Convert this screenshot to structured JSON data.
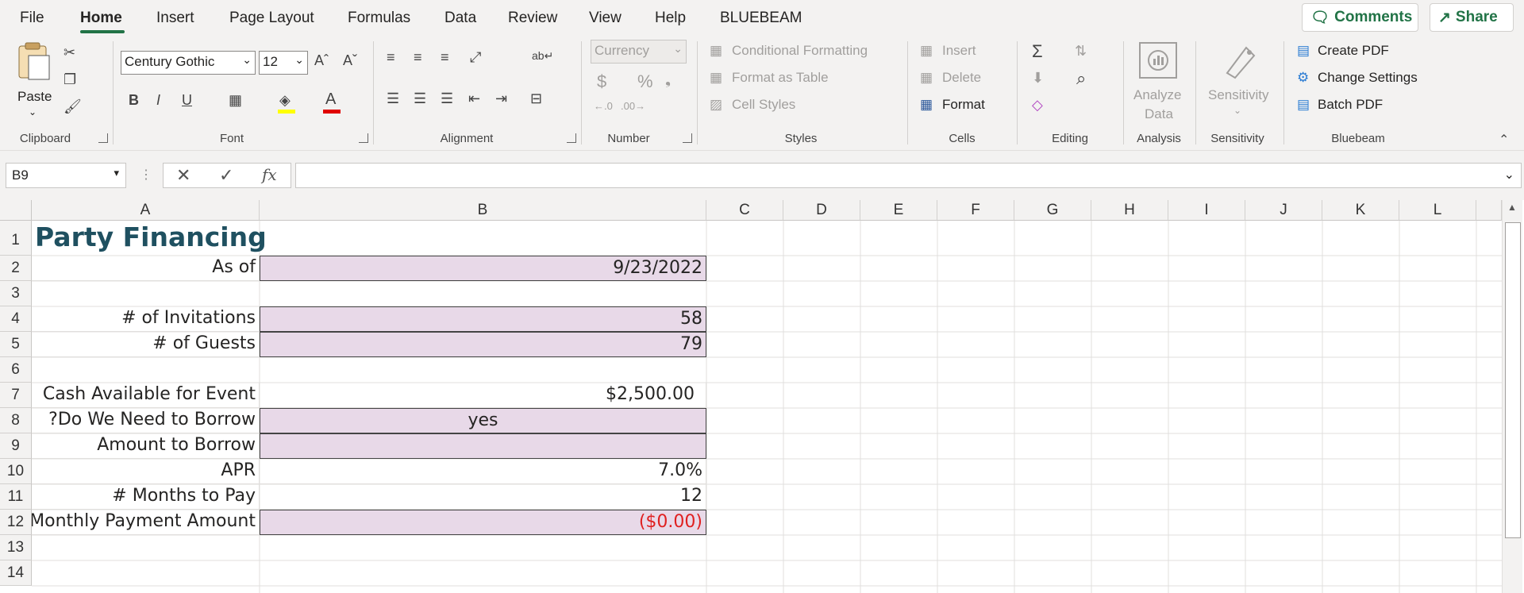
{
  "menu": {
    "tabs": [
      "File",
      "Home",
      "Insert",
      "Page Layout",
      "Formulas",
      "Data",
      "Review",
      "View",
      "Help",
      "BLUEBEAM"
    ],
    "active_tab": "Home",
    "comments_label": "Comments",
    "share_label": "Share"
  },
  "ribbon": {
    "clipboard": {
      "paste_label": "Paste",
      "group_label": "Clipboard"
    },
    "font": {
      "font_name": "Century Gothic",
      "font_size": "12",
      "group_label": "Font",
      "bold": "B",
      "italic": "I",
      "underline": "U"
    },
    "alignment": {
      "group_label": "Alignment"
    },
    "number": {
      "format": "Currency",
      "group_label": "Number",
      "currency_symbol": "$",
      "percent_symbol": "%"
    },
    "styles": {
      "conditional_formatting": "Conditional Formatting",
      "format_as_table": "Format as Table",
      "cell_styles": "Cell Styles",
      "group_label": "Styles"
    },
    "cells": {
      "insert": "Insert",
      "delete": "Delete",
      "format": "Format",
      "group_label": "Cells"
    },
    "editing": {
      "group_label": "Editing"
    },
    "analysis": {
      "analyze_data_line1": "Analyze",
      "analyze_data_line2": "Data",
      "group_label": "Analysis"
    },
    "sensitivity": {
      "label": "Sensitivity",
      "group_label": "Sensitivity"
    },
    "bluebeam": {
      "create_pdf": "Create PDF",
      "change_settings": "Change Settings",
      "batch_pdf": "Batch PDF",
      "group_label": "Bluebeam"
    }
  },
  "formula_bar": {
    "name_box": "B9",
    "formula": ""
  },
  "columns": [
    "A",
    "B",
    "C",
    "D",
    "E",
    "F",
    "G",
    "H",
    "I",
    "J",
    "K",
    "L"
  ],
  "rows": [
    "1",
    "2",
    "3",
    "4",
    "5",
    "6",
    "7",
    "8",
    "9",
    "10",
    "11",
    "12",
    "13",
    "14"
  ],
  "sheet": {
    "title": "Party Financing",
    "as_of_label": "As of",
    "as_of_value": "9/23/2022",
    "invitations_label": "# of Invitations",
    "invitations_value": "58",
    "guests_label": "# of Guests",
    "guests_value": "79",
    "cash_label": "Cash Available for Event",
    "cash_value": "$2,500.00",
    "borrow_q_label": "Do We Need to Borrow?",
    "borrow_q_value": "yes",
    "borrow_amount_label": "Amount to Borrow",
    "borrow_amount_value": "",
    "apr_label": "APR",
    "apr_value": "7.0%",
    "months_label": "# Months to Pay",
    "months_value": "12",
    "payment_label": "Monthly Payment Amount",
    "payment_value": "($0.00)"
  },
  "colors": {
    "accent": "#217346",
    "title": "#1f5060",
    "input_fill": "#e8d9e8",
    "negative": "#e02020"
  }
}
